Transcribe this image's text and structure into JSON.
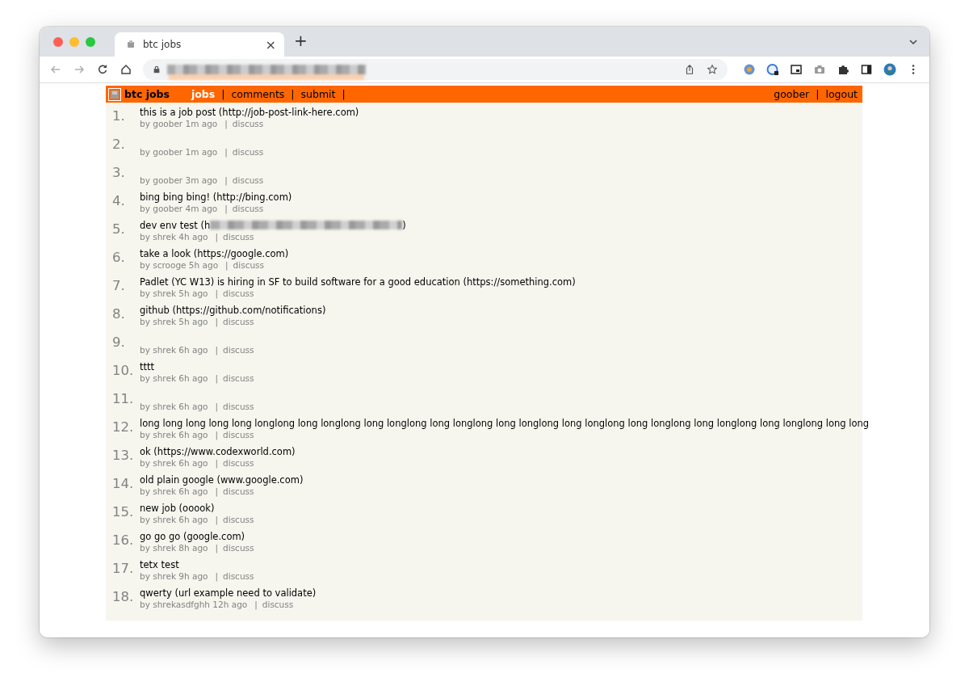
{
  "browser": {
    "tab": {
      "title": "btc jobs",
      "close": "×"
    },
    "new_tab": "+",
    "address": {
      "redacted": true
    }
  },
  "header": {
    "site": "btc jobs",
    "nav": [
      {
        "label": "jobs",
        "selected": true,
        "sep": "|"
      },
      {
        "label": "comments",
        "selected": false,
        "sep": "|"
      },
      {
        "label": "submit",
        "selected": false,
        "sep": "|"
      }
    ],
    "user": "goober",
    "sep": "|",
    "logout": "logout"
  },
  "items": [
    {
      "rank": "1.",
      "title": "this is a job post (http://job-post-link-here.com)",
      "meta": "by goober 1m ago",
      "sep": "|",
      "link": "discuss"
    },
    {
      "rank": "2.",
      "meta": "by goober 1m ago",
      "sep": "|",
      "link": "discuss"
    },
    {
      "rank": "3.",
      "meta": "by goober 3m ago",
      "sep": "|",
      "link": "discuss"
    },
    {
      "rank": "4.",
      "title": "bing bing bing! (http://bing.com)",
      "meta": "by goober 4m ago",
      "sep": "|",
      "link": "discuss"
    },
    {
      "rank": "5.",
      "title": "dev env test (h",
      "redacted": true,
      "title_end": ")",
      "meta": "by shrek 4h ago",
      "sep": "|",
      "link": "discuss"
    },
    {
      "rank": "6.",
      "title": "take a look (https://google.com)",
      "meta": "by scrooge 5h ago",
      "sep": "|",
      "link": "discuss"
    },
    {
      "rank": "7.",
      "title": "Padlet (YC W13) is hiring in SF to build software for a good education (https://something.com)",
      "meta": "by shrek 5h ago",
      "sep": "|",
      "link": "discuss"
    },
    {
      "rank": "8.",
      "title": "github (https://github.com/notifications)",
      "meta": "by shrek 5h ago",
      "sep": "|",
      "link": "discuss"
    },
    {
      "rank": "9.",
      "meta": "by shrek 6h ago",
      "sep": "|",
      "link": "discuss"
    },
    {
      "rank": "10.",
      "title": "tttt",
      "meta": "by shrek 6h ago",
      "sep": "|",
      "link": "discuss"
    },
    {
      "rank": "11.",
      "meta": "by shrek 6h ago",
      "sep": "|",
      "link": "discuss"
    },
    {
      "rank": "12.",
      "title": "long long long long long longlong long longlong long longlong long longlong long longlong long longlong long longlong long longlong long longlong long long",
      "meta": "by shrek 6h ago",
      "sep": "|",
      "link": "discuss"
    },
    {
      "rank": "13.",
      "title": "ok (https://www.codexworld.com)",
      "meta": "by shrek 6h ago",
      "sep": "|",
      "link": "discuss"
    },
    {
      "rank": "14.",
      "title": "old plain google (www.google.com)",
      "meta": "by shrek 6h ago",
      "sep": "|",
      "link": "discuss"
    },
    {
      "rank": "15.",
      "title": "new job (ooook)",
      "meta": "by shrek 6h ago",
      "sep": "|",
      "link": "discuss"
    },
    {
      "rank": "16.",
      "title": "go go go (google.com)",
      "meta": "by shrek 8h ago",
      "sep": "|",
      "link": "discuss"
    },
    {
      "rank": "17.",
      "title": "tetx test",
      "meta": "by shrek 9h ago",
      "sep": "|",
      "link": "discuss"
    },
    {
      "rank": "18.",
      "title": "qwerty (url example need to validate)",
      "meta": "by shrekasdfghh 12h ago",
      "sep": "|",
      "link": "discuss"
    }
  ]
}
